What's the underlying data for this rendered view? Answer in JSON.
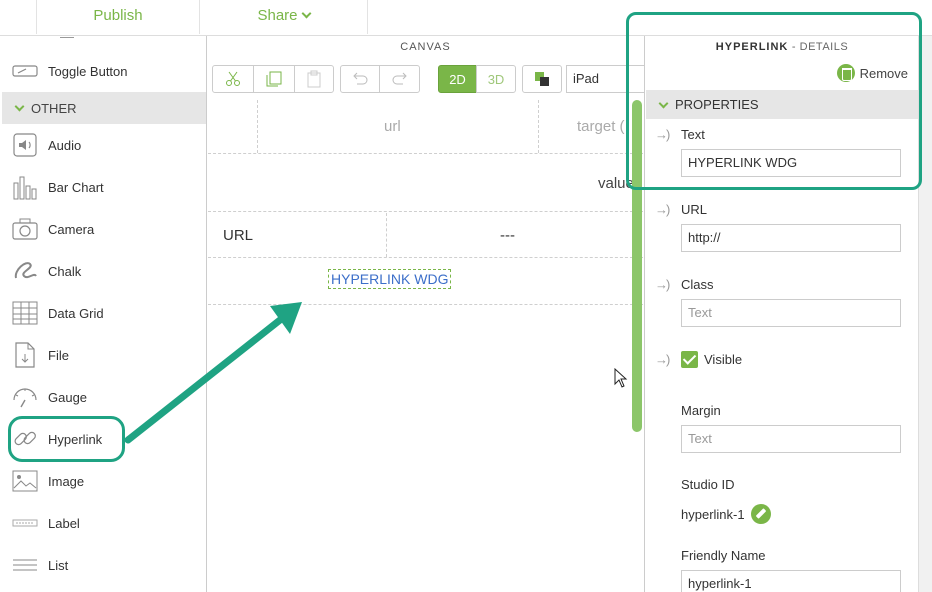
{
  "topbar": {
    "publish": "Publish",
    "share": "Share"
  },
  "palette": {
    "items_before": [
      {
        "label": "Toggle Button",
        "icon": "toggle-button-icon"
      }
    ],
    "section": "OTHER",
    "items": [
      {
        "label": "Audio",
        "icon": "audio-icon"
      },
      {
        "label": "Bar Chart",
        "icon": "bar-chart-icon"
      },
      {
        "label": "Camera",
        "icon": "camera-icon"
      },
      {
        "label": "Chalk",
        "icon": "chalk-icon"
      },
      {
        "label": "Data Grid",
        "icon": "data-grid-icon"
      },
      {
        "label": "File",
        "icon": "file-icon"
      },
      {
        "label": "Gauge",
        "icon": "gauge-icon"
      },
      {
        "label": "Hyperlink",
        "icon": "hyperlink-icon"
      },
      {
        "label": "Image",
        "icon": "image-icon"
      },
      {
        "label": "Label",
        "icon": "label-icon"
      },
      {
        "label": "List",
        "icon": "list-icon"
      }
    ]
  },
  "canvas": {
    "title": "CANVAS",
    "toolbar": {
      "mode_2d": "2D",
      "mode_3d": "3D",
      "device": "iPad"
    },
    "grid": {
      "row1": {
        "col_url": "url",
        "col_target": "target ("
      },
      "row2": {
        "value": "value"
      },
      "row3": {
        "label": "URL",
        "value": "---"
      },
      "widget_text": "HYPERLINK WDG"
    }
  },
  "details": {
    "title_bold": "HYPERLINK",
    "title_sub": "- DETAILS",
    "remove": "Remove",
    "section": "PROPERTIES",
    "text": {
      "label": "Text",
      "value": "HYPERLINK WDG"
    },
    "url": {
      "label": "URL",
      "value": "http://"
    },
    "class": {
      "label": "Class",
      "placeholder": "Text"
    },
    "visible": {
      "label": "Visible",
      "checked": true
    },
    "margin": {
      "label": "Margin",
      "placeholder": "Text"
    },
    "studio_id": {
      "label": "Studio ID",
      "value": "hyperlink-1"
    },
    "friendly_name": {
      "label": "Friendly Name",
      "value": "hyperlink-1"
    }
  },
  "colors": {
    "accent": "#7ab648",
    "annotation": "#1fa383",
    "link": "#3c6fc9"
  }
}
